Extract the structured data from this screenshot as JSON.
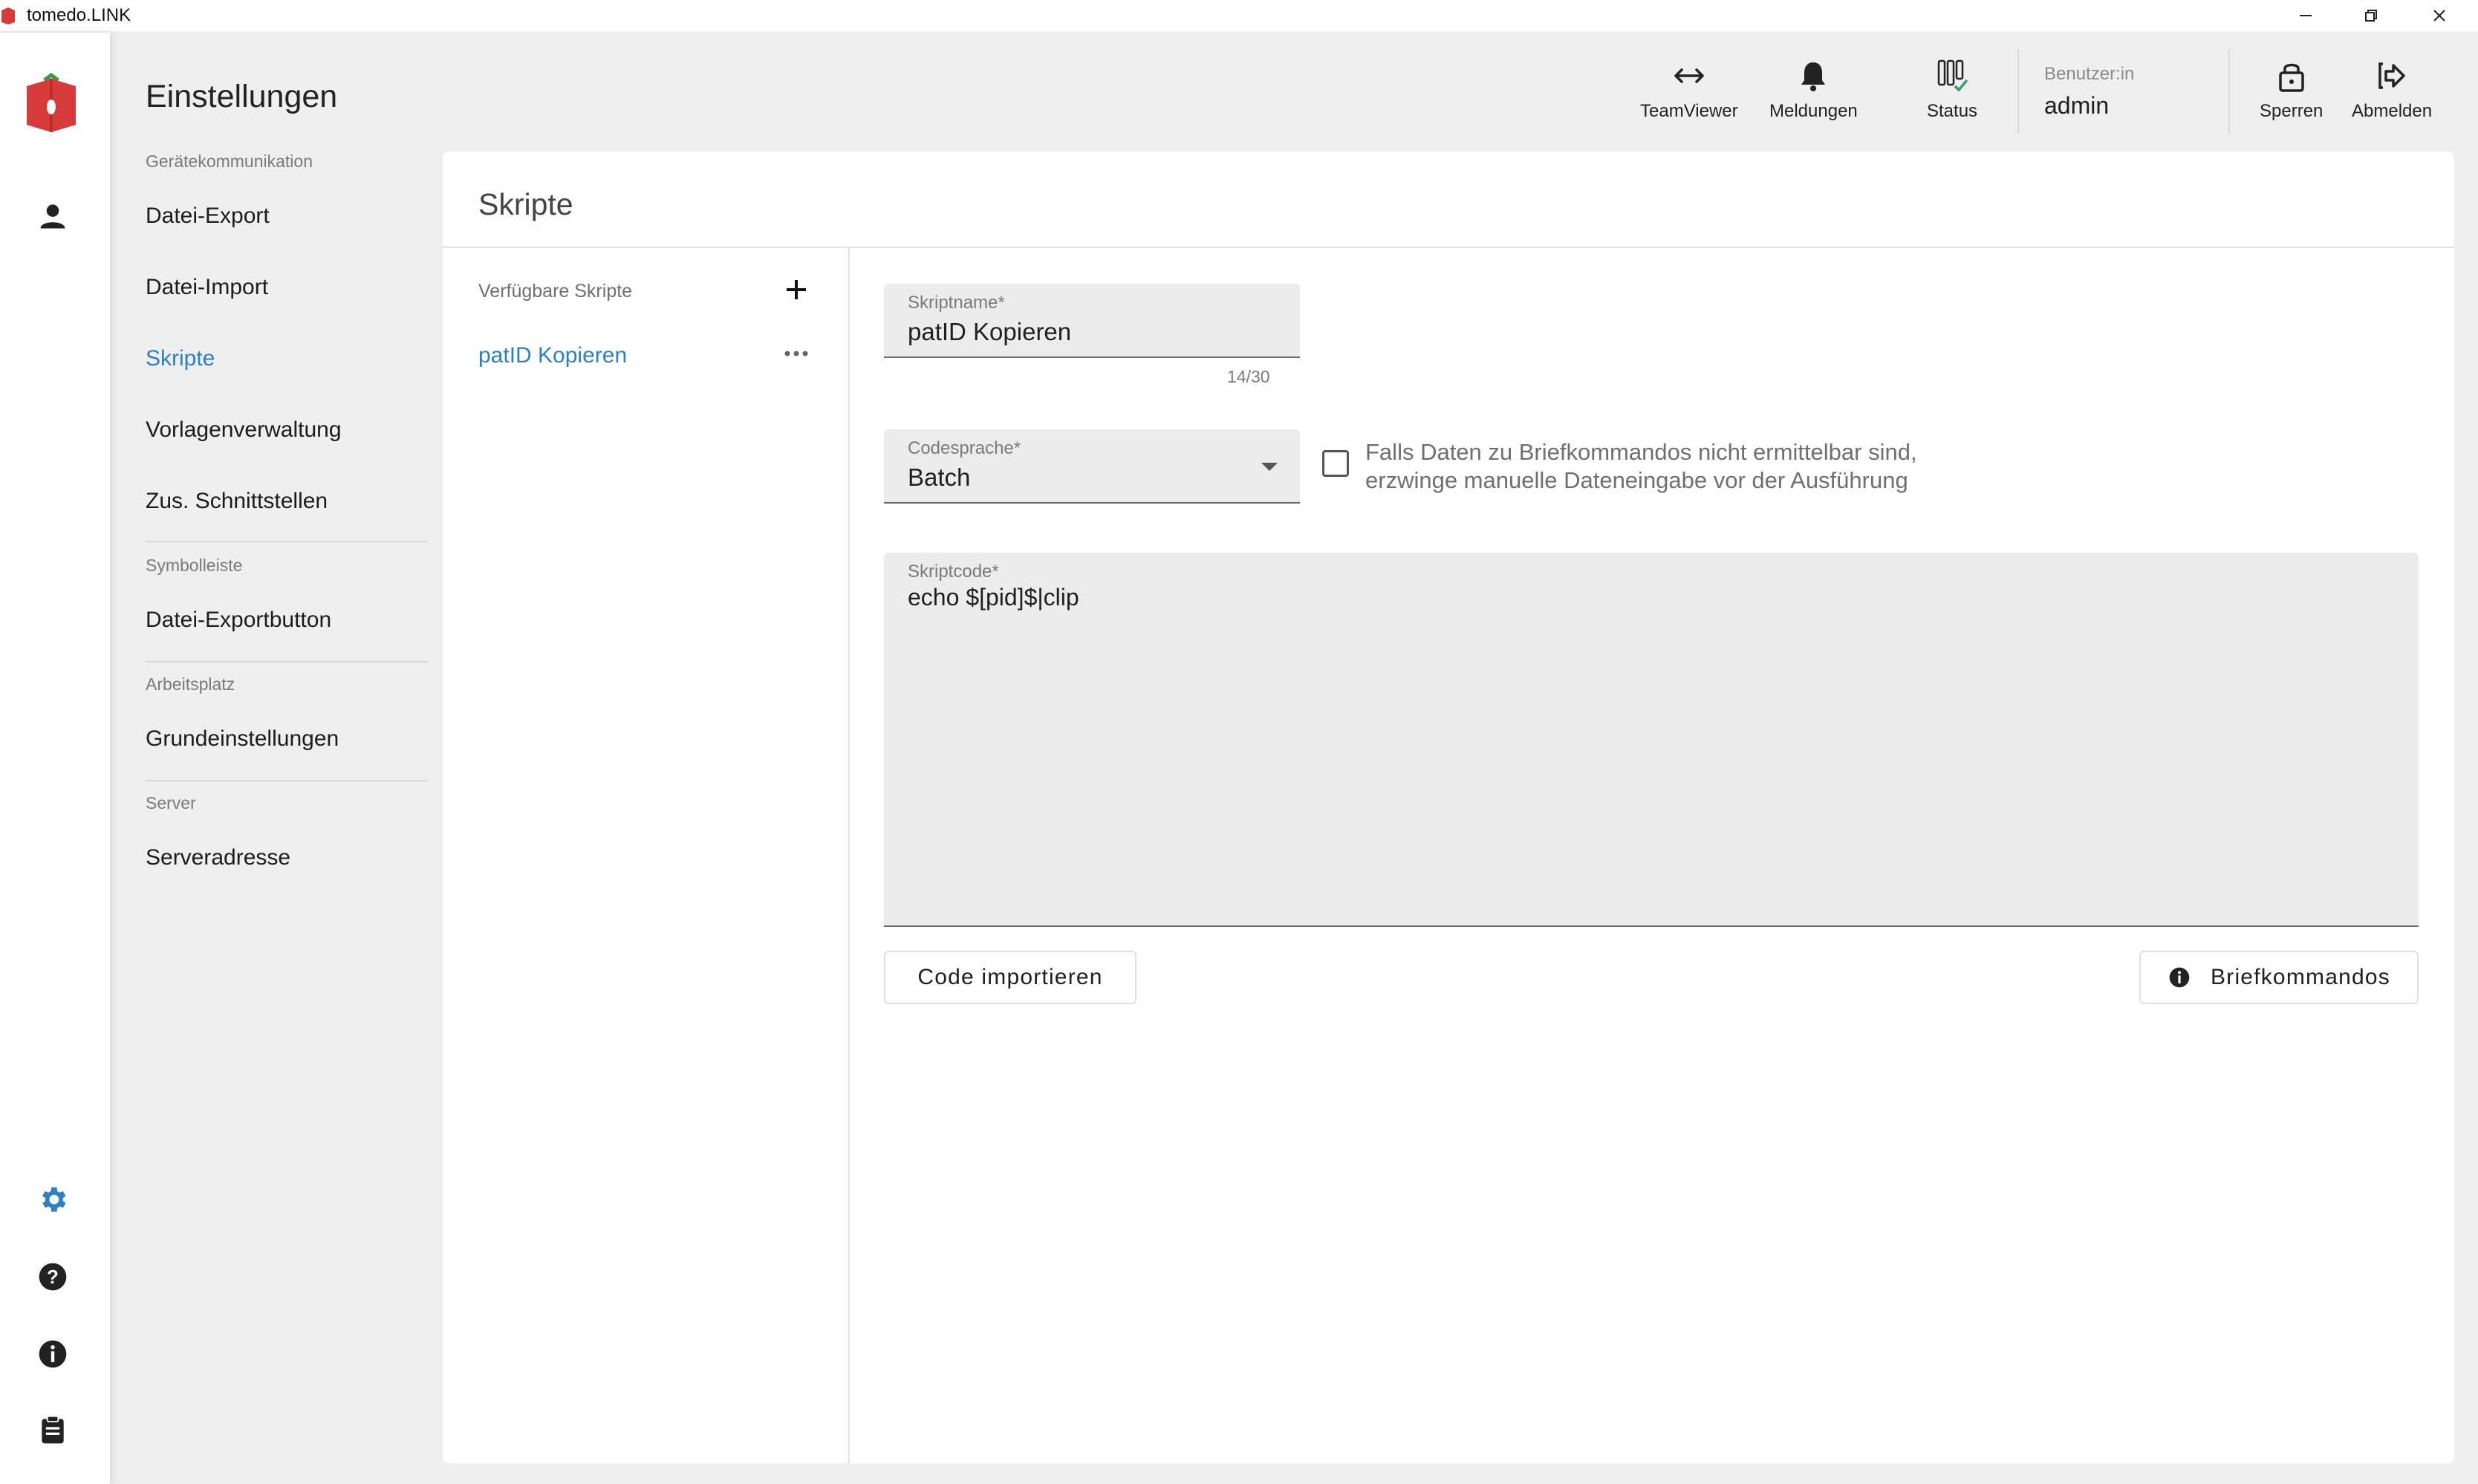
{
  "window": {
    "title": "tomedo.LINK"
  },
  "rail": {
    "icons": [
      "app-logo",
      "user-icon",
      "gear-icon",
      "help-icon",
      "info-icon",
      "clipboard-icon"
    ],
    "active_color": "#2f7fc4"
  },
  "nav": {
    "title": "Einstellungen",
    "sections": [
      {
        "label": "Gerätekommunikation",
        "items": [
          "Datei-Export",
          "Datei-Import",
          "Skripte",
          "Vorlagenverwaltung",
          "Zus. Schnittstellen"
        ]
      },
      {
        "label": "Symbolleiste",
        "items": [
          "Datei-Exportbutton"
        ]
      },
      {
        "label": "Arbeitsplatz",
        "items": [
          "Grundeinstellungen"
        ]
      },
      {
        "label": "Server",
        "items": [
          "Serveradresse"
        ]
      }
    ],
    "active_item": "Skripte"
  },
  "toolbar": {
    "teamviewer": "TeamViewer",
    "meldungen": "Meldungen",
    "status": "Status",
    "user_label": "Benutzer:in",
    "user_name": "admin",
    "sperren": "Sperren",
    "abmelden": "Abmelden"
  },
  "card": {
    "title": "Skripte",
    "list_header": "Verfügbare Skripte",
    "scripts": [
      "patID Kopieren"
    ]
  },
  "form": {
    "name_label": "Skriptname*",
    "name_value": "patID Kopieren",
    "name_counter": "14/30",
    "lang_label": "Codesprache*",
    "lang_value": "Batch",
    "checkbox_checked": false,
    "checkbox_line1": "Falls Daten zu Briefkommandos nicht ermittelbar sind,",
    "checkbox_line2": "erzwinge manuelle Dateneingabe vor der Ausführung",
    "code_label": "Skriptcode*",
    "code_value": "echo $[pid]$|clip",
    "import_button": "Code importieren",
    "brief_button": "Briefkommandos"
  },
  "colors": {
    "accent": "#2f7fc4",
    "logo_red": "#d63a3a",
    "field_bg": "#ececec"
  }
}
